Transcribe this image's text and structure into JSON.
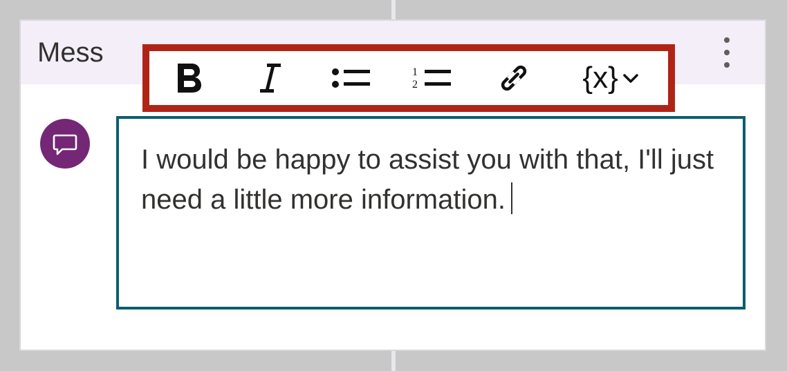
{
  "header": {
    "label": "Mess"
  },
  "toolbar": {
    "bold": {
      "name": "bold-icon"
    },
    "italic": {
      "name": "italic-icon"
    },
    "bullets": {
      "name": "bullet-list-icon"
    },
    "numbers": {
      "name": "numbered-list-icon"
    },
    "link": {
      "name": "link-icon"
    },
    "variable": {
      "label": "{x}"
    }
  },
  "node_icon": "message-icon",
  "editor": {
    "text": "I would be happy to assist you with that, I'll just need a little more information."
  },
  "colors": {
    "highlight_border": "#b02418",
    "editor_border": "#0b5d6e",
    "icon_bg": "#742774"
  }
}
